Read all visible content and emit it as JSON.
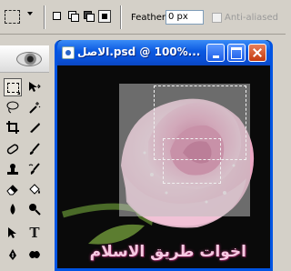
{
  "options_bar": {
    "feather_label": "Feather:",
    "feather_value": "0 px",
    "antialiased_label": "Anti-aliased",
    "antialiased_enabled": false,
    "active_selection_mode": "intersect"
  },
  "document": {
    "title": "الاصل.psd @ 100%...",
    "caption": "اخوات طريق الاسلام"
  },
  "tools_palette": {
    "selected_tool": "marquee-tool"
  },
  "colors": {
    "titlebar": "#0a58e0",
    "close_button": "#c43a10",
    "caption_text": "#f6c9e2",
    "canvas_background": "#0a0a0a"
  }
}
